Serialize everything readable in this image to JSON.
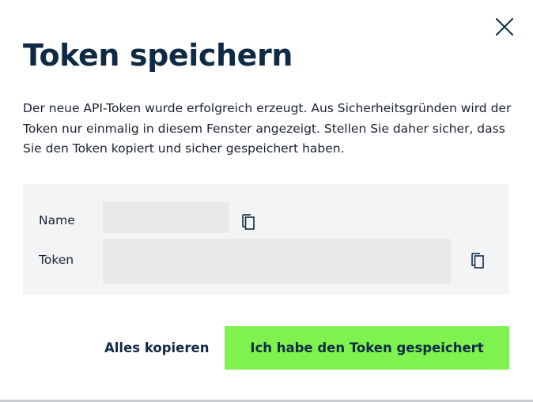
{
  "dialog": {
    "title": "Token speichern",
    "description": "Der neue API-Token wurde erfolgreich erzeugt. Aus Sicherheitsgründen wird der Token nur einmalig in diesem Fenster angezeigt. Stellen Sie daher sicher, dass Sie den Token kopiert und sicher gespeichert haben.",
    "close_icon": "close-icon"
  },
  "fields": {
    "name": {
      "label": "Name",
      "value": "",
      "copy_icon": "copy-icon"
    },
    "token": {
      "label": "Token",
      "value": "",
      "copy_icon": "copy-icon"
    }
  },
  "actions": {
    "copy_all_label": "Alles kopieren",
    "saved_label": "Ich habe den Token gespeichert"
  },
  "colors": {
    "text_dark": "#0f2a44",
    "panel_bg": "#f3f4f5",
    "field_bg": "#e7e9eb",
    "primary_button": "#7ef24f"
  }
}
